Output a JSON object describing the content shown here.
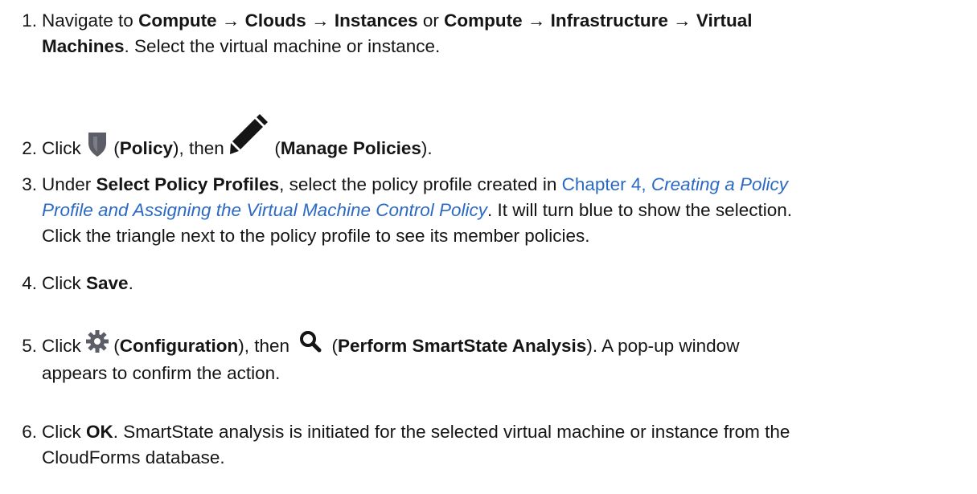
{
  "colors": {
    "text": "#151515",
    "link": "#2b6ac4",
    "icon": "#6d6d6d"
  },
  "steps": [
    {
      "number": "1.",
      "p1": "Navigate to ",
      "b1": "Compute → Clouds → Instances",
      "p2": " or ",
      "b2": "Compute → Infrastructure → Virtual",
      "b3": "Machines",
      "p3": ". Select the virtual machine or instance."
    },
    {
      "number": "2.",
      "p1": "Click ",
      "p2": " (",
      "b1": "Policy",
      "p3": "), then ",
      "p4": " (",
      "b2": "Manage Policies",
      "p5": ").",
      "icon1": "shield-icon",
      "icon2": "pencil-icon"
    },
    {
      "number": "3.",
      "p1": "Under ",
      "b1": "Select Policy Profiles",
      "p2": ", select the policy profile created in ",
      "link_chapter": "Chapter 4, ",
      "link_title1": "Creating a Policy",
      "link_title2": "Profile and Assigning the Virtual Machine Control Policy",
      "p3": ". It will turn blue to show the selection.",
      "line3": "Click the triangle next to the policy profile to see its member policies."
    },
    {
      "number": "4.",
      "p1": "Click ",
      "b1": "Save",
      "p2": "."
    },
    {
      "number": "5.",
      "p1": "Click ",
      "p2": " (",
      "b1": "Configuration",
      "p3": "), then ",
      "p4": " (",
      "b2": "Perform SmartState Analysis",
      "p5": "). A pop-up window",
      "line2": "appears to confirm the action.",
      "icon1": "gear-icon",
      "icon2": "search-icon"
    },
    {
      "number": "6.",
      "p1": "Click ",
      "b1": "OK",
      "p2": ". SmartState analysis is initiated for the selected virtual machine or instance from the",
      "line2": "CloudForms database."
    }
  ]
}
